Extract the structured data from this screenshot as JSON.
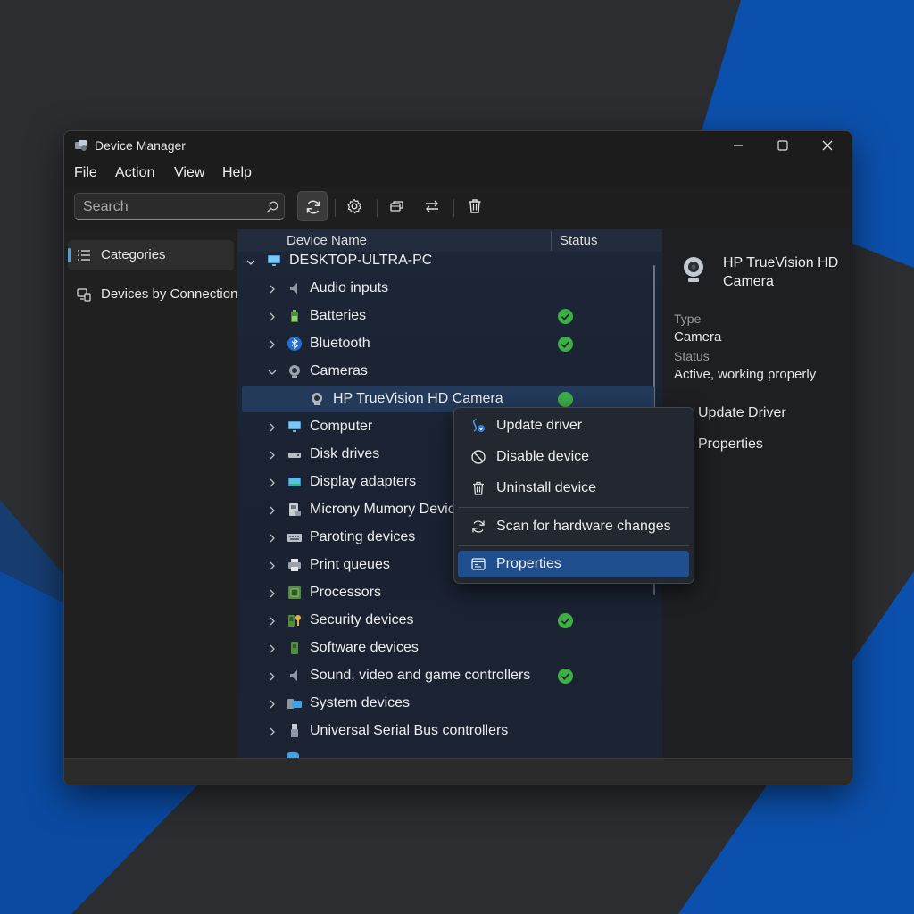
{
  "window": {
    "title": "Device Manager"
  },
  "menu": [
    "File",
    "Action",
    "View",
    "Help"
  ],
  "toolbar": {
    "search_placeholder": "Search"
  },
  "nav": [
    {
      "label": "Categories",
      "icon": "list-icon",
      "selected": true
    },
    {
      "label": "Devices by Connection",
      "icon": "devices-icon",
      "selected": false
    }
  ],
  "tree": {
    "columns": {
      "name": "Device Name",
      "status": "Status"
    },
    "root": "DESKTOP-ULTRA-PC",
    "items": [
      {
        "label": "Audio inputs",
        "icon": "speaker-icon",
        "status": ""
      },
      {
        "label": "Batteries",
        "icon": "battery-icon",
        "status": "ok"
      },
      {
        "label": "Bluetooth",
        "icon": "bluetooth-icon",
        "status": "ok"
      },
      {
        "label": "Cameras",
        "icon": "camera-icon",
        "status": "",
        "expanded": true
      },
      {
        "label": "HP TrueVision HD Camera",
        "icon": "webcam-icon",
        "status": "ok",
        "child": true,
        "selected": true
      },
      {
        "label": "Computer",
        "icon": "monitor-icon",
        "status": ""
      },
      {
        "label": "Disk drives",
        "icon": "disk-icon",
        "status": ""
      },
      {
        "label": "Display adapters",
        "icon": "display-adapter-icon",
        "status": ""
      },
      {
        "label": "Microny Mumory Devices",
        "icon": "memory-icon",
        "status": ""
      },
      {
        "label": "Paroting devices",
        "icon": "keyboard-icon",
        "status": ""
      },
      {
        "label": "Print queues",
        "icon": "printer-icon",
        "status": ""
      },
      {
        "label": "Processors",
        "icon": "chip-icon",
        "status": ""
      },
      {
        "label": "Security devices",
        "icon": "security-key-icon",
        "status": "ok"
      },
      {
        "label": "Software devices",
        "icon": "software-device-icon",
        "status": ""
      },
      {
        "label": "Sound, video and game controllers",
        "icon": "speaker-icon",
        "status": "ok"
      },
      {
        "label": "System devices",
        "icon": "system-icon",
        "status": ""
      },
      {
        "label": "Universal Serial Bus controllers",
        "icon": "usb-icon",
        "status": ""
      }
    ]
  },
  "details": {
    "device_name": "HP TrueVision HD Camera",
    "type_label": "Type",
    "type_value": "Camera",
    "status_label": "Status",
    "status_value": "Active, working properly",
    "actions": [
      "Update Driver",
      "Properties"
    ]
  },
  "context_menu": [
    {
      "label": "Update driver",
      "icon": "update-driver-icon"
    },
    {
      "label": "Disable device",
      "icon": "disable-icon"
    },
    {
      "label": "Uninstall device",
      "icon": "trash-icon"
    },
    {
      "label": "Scan for hardware changes",
      "icon": "refresh-icon"
    },
    {
      "label": "Properties",
      "icon": "properties-icon",
      "highlighted": true
    }
  ],
  "colors": {
    "accent": "#1f4f8e",
    "status_ok": "#3fae49",
    "wallpaper_blue": "#0b4fb0"
  }
}
